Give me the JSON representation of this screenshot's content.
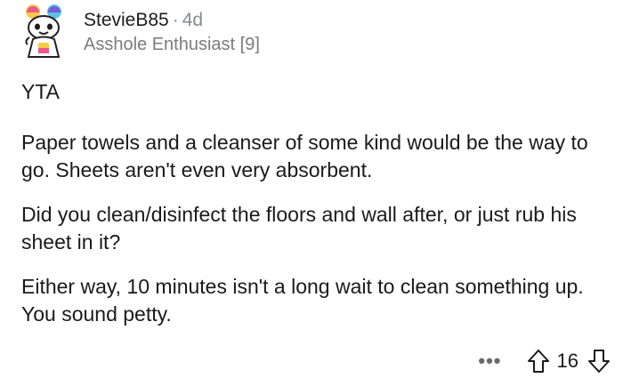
{
  "comment": {
    "author": "StevieB85",
    "separator": "·",
    "age": "4d",
    "flair": "Asshole Enthusiast [9]",
    "paragraphs": [
      "YTA",
      "Paper towels and a cleanser of some kind would be the way to go. Sheets aren't even very absorbent.",
      "Did you clean/disinfect the floors and wall after, or just rub his sheet in it?",
      "Either way, 10 minutes isn't a long wait to clean something up. You sound petty."
    ],
    "more_label": "•••",
    "score": "16"
  },
  "icons": {
    "avatar": "snoo-avatar",
    "upvote": "arrow-up-outline-icon",
    "downvote": "arrow-down-outline-icon"
  }
}
